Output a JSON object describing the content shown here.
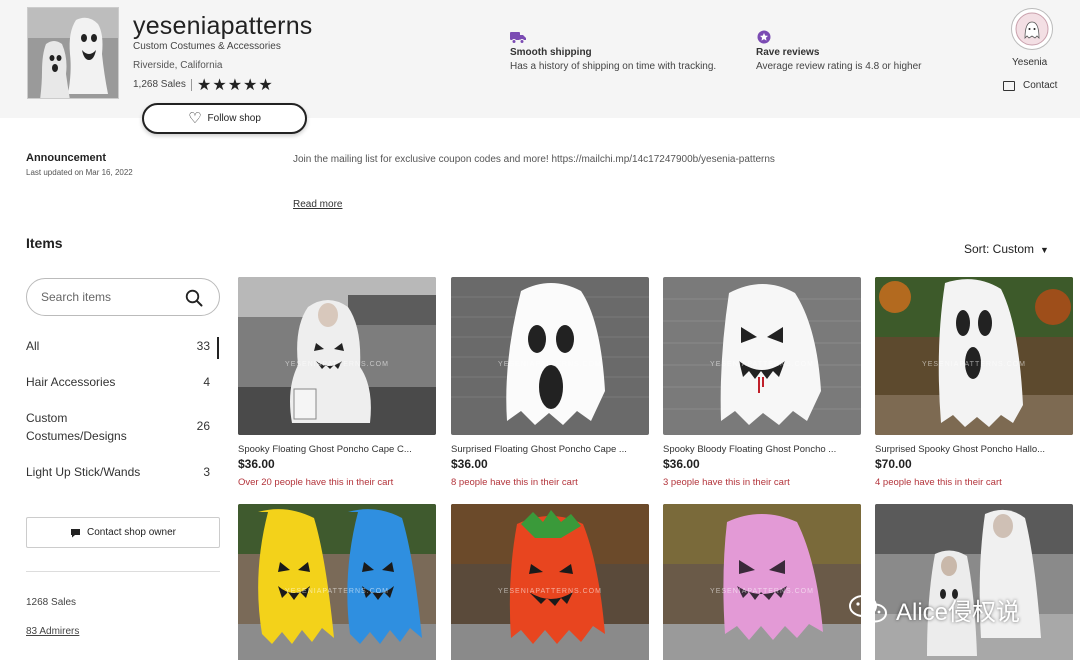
{
  "shop": {
    "name": "yeseniapatterns",
    "tagline": "Custom Costumes & Accessories",
    "location": "Riverside, California",
    "sales": "1,268 Sales",
    "rating_stars": 5,
    "stars_text": "★★★★★",
    "follow_label": "Follow shop"
  },
  "features": [
    {
      "icon": "truck-icon",
      "title": "Smooth shipping",
      "desc": "Has a history of shipping on time with tracking."
    },
    {
      "icon": "star-badge-icon",
      "title": "Rave reviews",
      "desc": "Average review rating is 4.8 or higher"
    }
  ],
  "owner": {
    "name": "Yesenia",
    "contact_label": "Contact"
  },
  "announcement": {
    "title": "Announcement",
    "updated": "Last updated on Mar 16, 2022",
    "text": "Join the mailing list for exclusive coupon codes and more! https://mailchi.mp/14c17247900b/yesenia-patterns",
    "read_more": "Read more"
  },
  "items": {
    "heading": "Items",
    "sort_label": "Sort: Custom",
    "search_placeholder": "Search items",
    "categories": [
      {
        "label": "All",
        "count": "33",
        "active": true
      },
      {
        "label": "Hair Accessories",
        "count": "4"
      },
      {
        "label": "Custom Costumes/Designs",
        "count": "26"
      },
      {
        "label": "Light Up Stick/Wands",
        "count": "3"
      }
    ],
    "contact_owner": "Contact shop owner",
    "sales_text": "1268 Sales",
    "admirers_text": "83 Admirers"
  },
  "products": [
    {
      "title": "Spooky Floating Ghost Poncho Cape C...",
      "price": "$36.00",
      "cart": "Over 20 people have this in their cart"
    },
    {
      "title": "Surprised Floating Ghost Poncho Cape ...",
      "price": "$36.00",
      "cart": "8 people have this in their cart"
    },
    {
      "title": "Spooky Bloody Floating Ghost Poncho ...",
      "price": "$36.00",
      "cart": "3 people have this in their cart"
    },
    {
      "title": "Surprised Spooky Ghost Poncho Hallo...",
      "price": "$70.00",
      "cart": "4 people have this in their cart"
    }
  ],
  "watermark": "YESENIAPATTERNS.COM",
  "overlay_badge": "Alice侵权说",
  "colors": {
    "header_bg": "#f5f5f5",
    "cart_text": "#b3343b",
    "accent_purple": "#7b4bb3"
  }
}
